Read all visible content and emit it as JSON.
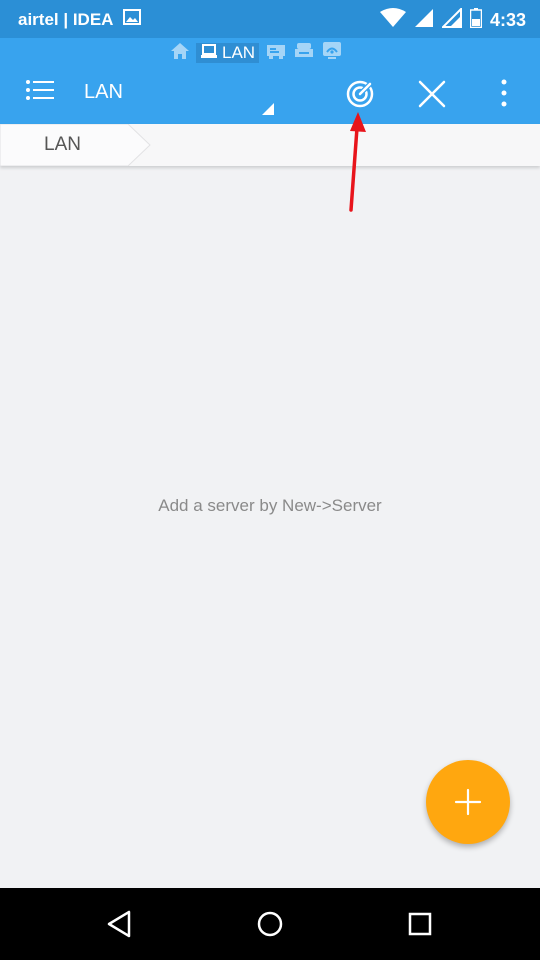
{
  "status_bar": {
    "carrier": "airtel | IDEA",
    "time": "4:33",
    "icons": [
      "gallery-icon",
      "wifi-icon",
      "signal-icon",
      "signal-icon",
      "battery-icon"
    ]
  },
  "nav_strip": {
    "items": [
      "home-icon",
      "lan-icon",
      "ftp-icon",
      "android-icon",
      "cast-icon"
    ],
    "active_label": "LAN"
  },
  "toolbar": {
    "title": "LAN",
    "actions": [
      "scan-icon",
      "close-icon",
      "more-vert-icon"
    ]
  },
  "breadcrumb": {
    "items": [
      "LAN"
    ]
  },
  "content": {
    "empty_message": "Add a server by New->Server"
  },
  "fab": {
    "icon": "plus-icon"
  },
  "colors": {
    "status_bar": "#2b8fd6",
    "appbar": "#38a3ee",
    "background": "#f1f2f4",
    "fab": "#ffa70f",
    "annotation": "#e8141b"
  }
}
